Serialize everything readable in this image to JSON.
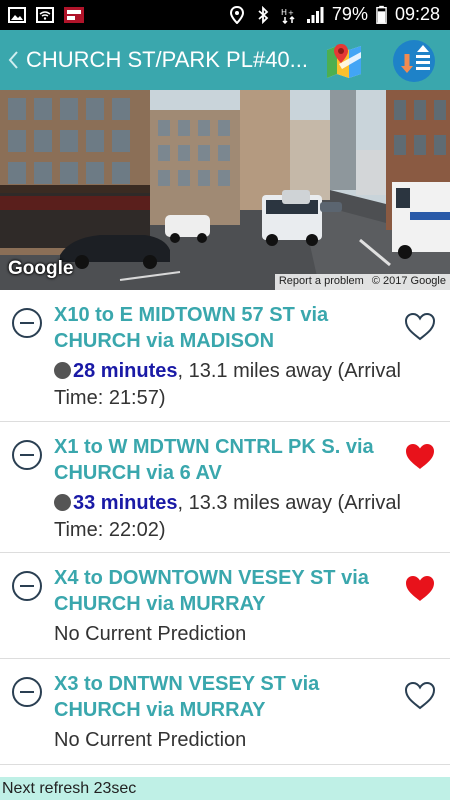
{
  "status_bar": {
    "battery": "79%",
    "time": "09:28",
    "icons": [
      "image-icon",
      "wifi-icon",
      "app-icon",
      "location-icon",
      "bluetooth-icon",
      "network-icon",
      "signal-icon",
      "battery-icon"
    ]
  },
  "app_bar": {
    "title": "CHURCH ST/PARK PL#40...",
    "back_icon": "chevron-left-icon",
    "maps_icon": "google-maps-icon",
    "sort_icon": "sort-arrows-icon"
  },
  "street_view": {
    "logo": "Google",
    "report": "Report a problem",
    "copyright": "© 2017 Google"
  },
  "routes": [
    {
      "name": "X10 to E MIDTOWN 57 ST via CHURCH via MADISON",
      "minutes": "28 minutes",
      "detail": ", 13.1 miles away (Arrival Time: 21:57)",
      "favorite": false
    },
    {
      "name": "X1 to W MDTWN CNTRL PK S. via CHURCH via 6 AV",
      "minutes": "33 minutes",
      "detail": ", 13.3 miles away (Arrival Time: 22:02)",
      "favorite": true
    },
    {
      "name": "X4 to DOWNTOWN VESEY ST via CHURCH via MURRAY",
      "minutes": "",
      "detail": "No Current Prediction",
      "favorite": true
    },
    {
      "name": "X3 to DNTWN VESEY ST via CHURCH via MURRAY",
      "minutes": "",
      "detail": "No Current Prediction",
      "favorite": false
    }
  ],
  "footer": {
    "refresh": "Next refresh 23sec"
  },
  "colors": {
    "accent": "#3aa7ad",
    "minutes": "#1a1aa6",
    "heart": "#e8121b",
    "footer_bg": "#bff0e6"
  }
}
